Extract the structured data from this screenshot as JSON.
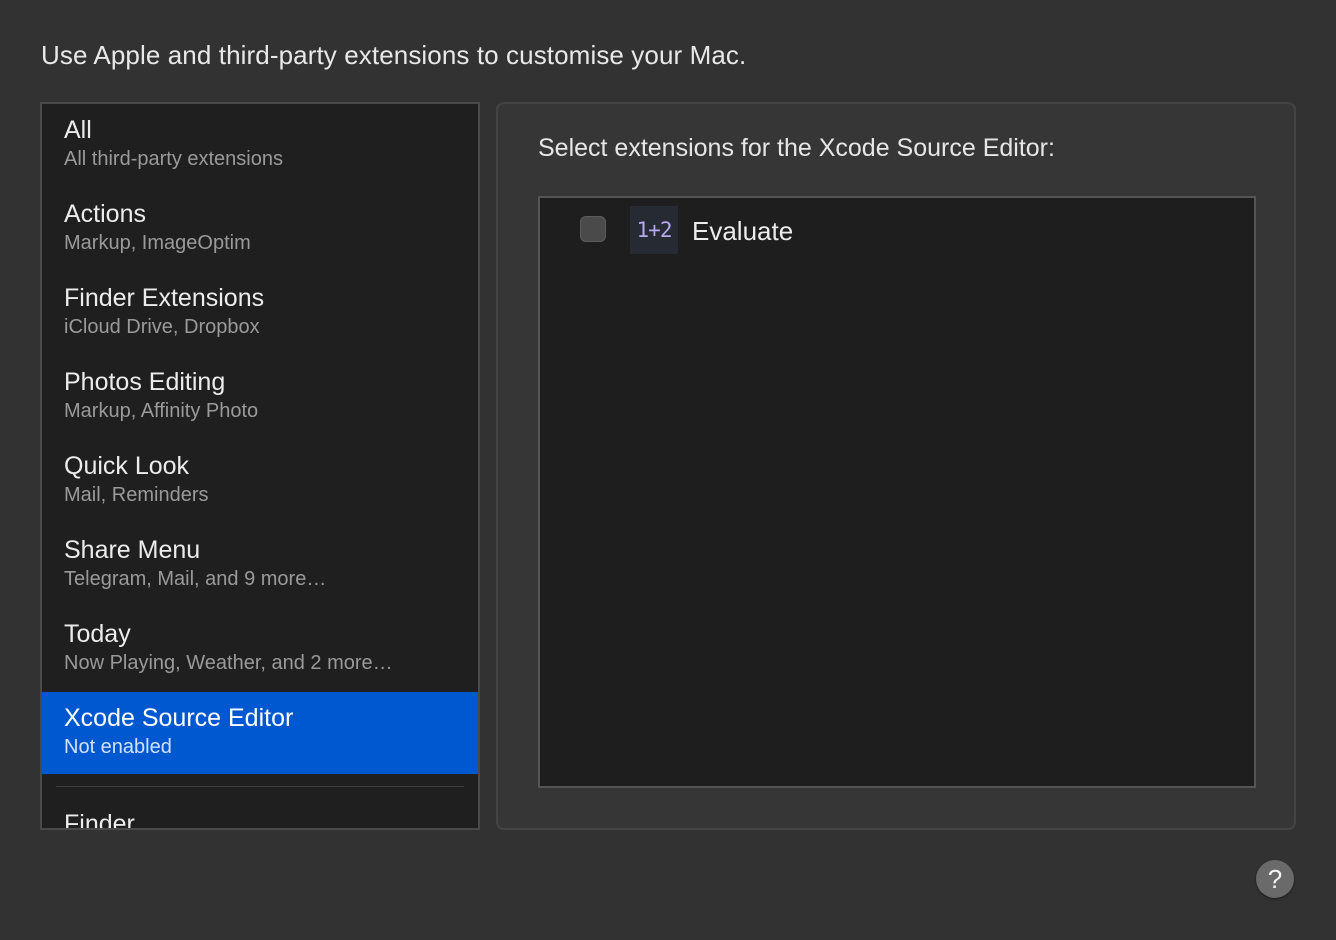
{
  "header": {
    "description": "Use Apple and third-party extensions to customise your Mac."
  },
  "sidebar": {
    "items": [
      {
        "title": "All",
        "subtitle": "All third-party extensions"
      },
      {
        "title": "Actions",
        "subtitle": "Markup, ImageOptim"
      },
      {
        "title": "Finder Extensions",
        "subtitle": "iCloud Drive, Dropbox"
      },
      {
        "title": "Photos Editing",
        "subtitle": "Markup, Affinity Photo"
      },
      {
        "title": "Quick Look",
        "subtitle": "Mail, Reminders"
      },
      {
        "title": "Share Menu",
        "subtitle": "Telegram, Mail, and 9 more…"
      },
      {
        "title": "Today",
        "subtitle": "Now Playing, Weather, and 2 more…"
      },
      {
        "title": "Xcode Source Editor",
        "subtitle": "Not enabled"
      }
    ],
    "section_partial": "Finder",
    "selected_index": 7
  },
  "panel": {
    "title": "Select extensions for the Xcode Source Editor:",
    "extensions": [
      {
        "icon_text": "1+2",
        "label": "Evaluate",
        "checked": false
      }
    ]
  },
  "help": {
    "label": "?"
  },
  "colors": {
    "selection": "#0058d0",
    "background": "#323232",
    "list_background": "#1e1e1e",
    "icon_text": "#b8a7f2"
  }
}
